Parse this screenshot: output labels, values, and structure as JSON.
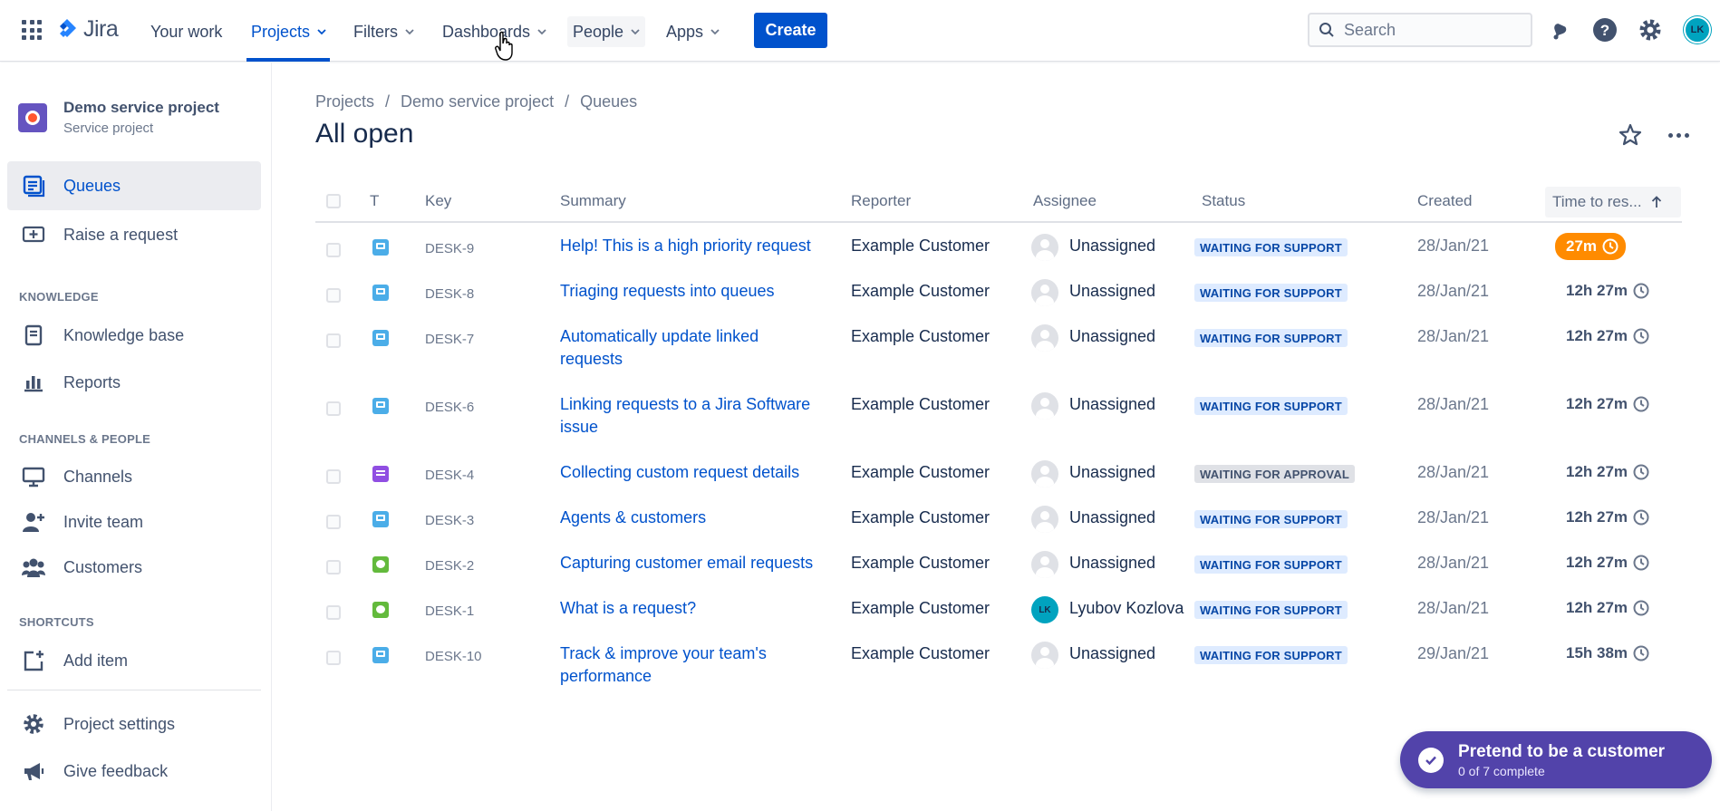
{
  "topnav": {
    "brand": "Jira",
    "items": [
      {
        "label": "Your work",
        "has_chevron": false
      },
      {
        "label": "Projects",
        "has_chevron": true,
        "active": true
      },
      {
        "label": "Filters",
        "has_chevron": true
      },
      {
        "label": "Dashboards",
        "has_chevron": true
      },
      {
        "label": "People",
        "has_chevron": true,
        "hover": true
      },
      {
        "label": "Apps",
        "has_chevron": true
      }
    ],
    "create_label": "Create",
    "search_placeholder": "Search",
    "avatar_initials": "LK",
    "accent_color": "#0052cc"
  },
  "sidebar": {
    "project_name": "Demo service project",
    "project_type": "Service project",
    "items": [
      {
        "label": "Queues",
        "icon": "queues-icon",
        "active": true
      },
      {
        "label": "Raise a request",
        "icon": "raise-request-icon"
      }
    ],
    "sections": [
      {
        "title": "KNOWLEDGE",
        "items": [
          {
            "label": "Knowledge base",
            "icon": "knowledge-base-icon"
          },
          {
            "label": "Reports",
            "icon": "reports-icon"
          }
        ]
      },
      {
        "title": "CHANNELS & PEOPLE",
        "items": [
          {
            "label": "Channels",
            "icon": "channels-icon"
          },
          {
            "label": "Invite team",
            "icon": "invite-team-icon"
          },
          {
            "label": "Customers",
            "icon": "customers-icon"
          }
        ]
      },
      {
        "title": "SHORTCUTS",
        "items": [
          {
            "label": "Add item",
            "icon": "add-item-icon"
          }
        ]
      }
    ],
    "footer": [
      {
        "label": "Project settings",
        "icon": "gear-icon"
      },
      {
        "label": "Give feedback",
        "icon": "megaphone-icon"
      }
    ]
  },
  "main": {
    "breadcrumb": [
      "Projects",
      "Demo service project",
      "Queues"
    ],
    "title": "All open",
    "columns": {
      "type": "T",
      "key": "Key",
      "summary": "Summary",
      "reporter": "Reporter",
      "assignee": "Assignee",
      "status": "Status",
      "created": "Created",
      "ttr": "Time to res..."
    },
    "rows": [
      {
        "type": "service",
        "key": "DESK-9",
        "summary": "Help! This is a high priority request",
        "reporter": "Example Customer",
        "assignee": "Unassigned",
        "status": "WAITING FOR SUPPORT",
        "status_kind": "support",
        "created": "28/Jan/21",
        "ttr": "27m",
        "urgent": true
      },
      {
        "type": "service",
        "key": "DESK-8",
        "summary": "Triaging requests into queues",
        "reporter": "Example Customer",
        "assignee": "Unassigned",
        "status": "WAITING FOR SUPPORT",
        "status_kind": "support",
        "created": "28/Jan/21",
        "ttr": "12h 27m"
      },
      {
        "type": "service",
        "key": "DESK-7",
        "summary": "Automatically update linked requests",
        "reporter": "Example Customer",
        "assignee": "Unassigned",
        "status": "WAITING FOR SUPPORT",
        "status_kind": "support",
        "created": "28/Jan/21",
        "ttr": "12h 27m"
      },
      {
        "type": "service",
        "key": "DESK-6",
        "summary": "Linking requests to a Jira Software issue",
        "reporter": "Example Customer",
        "assignee": "Unassigned",
        "status": "WAITING FOR SUPPORT",
        "status_kind": "support",
        "created": "28/Jan/21",
        "ttr": "12h 27m"
      },
      {
        "type": "form",
        "key": "DESK-4",
        "summary": "Collecting custom request details",
        "reporter": "Example Customer",
        "assignee": "Unassigned",
        "status": "WAITING FOR APPROVAL",
        "status_kind": "approval",
        "created": "28/Jan/21",
        "ttr": "12h 27m"
      },
      {
        "type": "service",
        "key": "DESK-3",
        "summary": "Agents & customers",
        "reporter": "Example Customer",
        "assignee": "Unassigned",
        "status": "WAITING FOR SUPPORT",
        "status_kind": "support",
        "created": "28/Jan/21",
        "ttr": "12h 27m"
      },
      {
        "type": "chat",
        "key": "DESK-2",
        "summary": "Capturing customer email requests",
        "reporter": "Example Customer",
        "assignee": "Unassigned",
        "status": "WAITING FOR SUPPORT",
        "status_kind": "support",
        "created": "28/Jan/21",
        "ttr": "12h 27m"
      },
      {
        "type": "chat",
        "key": "DESK-1",
        "summary": "What is a request?",
        "reporter": "Example Customer",
        "assignee": "Lyubov Kozlova",
        "assignee_initials": "LK",
        "status": "WAITING FOR SUPPORT",
        "status_kind": "support",
        "created": "28/Jan/21",
        "ttr": "12h 27m"
      },
      {
        "type": "service",
        "key": "DESK-10",
        "summary": "Track & improve your team's performance",
        "reporter": "Example Customer",
        "assignee": "Unassigned",
        "status": "WAITING FOR SUPPORT",
        "status_kind": "support",
        "created": "29/Jan/21",
        "ttr": "15h 38m"
      }
    ]
  },
  "toast": {
    "title": "Pretend to be a customer",
    "subtitle": "0 of 7 complete"
  }
}
